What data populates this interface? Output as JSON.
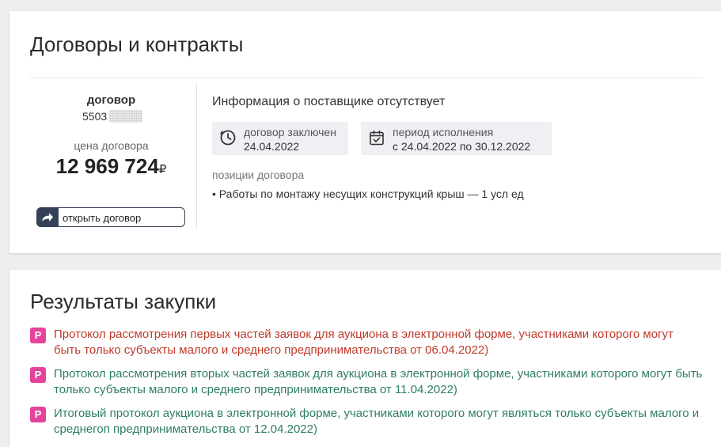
{
  "contracts": {
    "title": "Договоры и контракты",
    "contract_label": "договор",
    "contract_number": "5503",
    "price_label": "цена договора",
    "price_value": "12 969 724",
    "currency": "₽",
    "open_button": "открыть договор",
    "supplier_info": "Информация о поставщике отсутствует",
    "concluded_label": "договор заключен",
    "concluded_date": "24.04.2022",
    "period_label": "период исполнения",
    "period_value": "с 24.04.2022 по 30.12.2022",
    "positions_label": "позиции договора",
    "positions": [
      "• Работы по монтажу несущих конструкций крыш — 1 усл ед"
    ]
  },
  "results": {
    "title": "Результаты закупки",
    "badge": "P",
    "items": [
      {
        "text": "Протокол рассмотрения первых частей заявок для аукциона в электронной форме, участниками которого могут быть только субъекты малого и среднего предпринимательства от 06.04.2022)",
        "color": "#c0392b"
      },
      {
        "text": "Протокол рассмотрения вторых частей заявок для аукциона в электронной форме, участниками которого могут быть только субъекты малого и среднего предпринимательства от 11.04.2022)",
        "color": "#2e7d65"
      },
      {
        "text": "Итоговый протокол аукциона в электронной форме, участниками которого могут являться только субъекты малого и среднегоп предпринимательства от 12.04.2022)",
        "color": "#2e7d65"
      }
    ]
  },
  "colors": {
    "badge": "#e4459a",
    "button_dark": "#334055",
    "info_box_bg": "#eef0f3"
  }
}
